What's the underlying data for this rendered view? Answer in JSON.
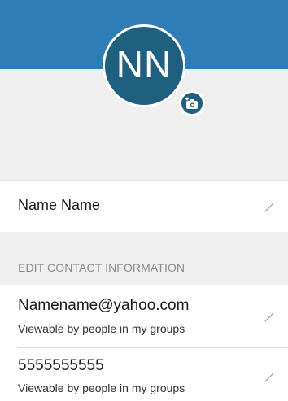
{
  "profile": {
    "initials": "NN",
    "name": "Name Name"
  },
  "section": {
    "header": "EDIT CONTACT INFORMATION"
  },
  "contacts": [
    {
      "value": "Namename@yahoo.com",
      "visibility": "Viewable by people in my groups"
    },
    {
      "value": "5555555555",
      "visibility": "Viewable by people in my groups"
    }
  ],
  "icons": {
    "camera": "camera-plus-icon",
    "edit": "pencil-icon"
  },
  "colors": {
    "header_blue": "#2e7db6",
    "avatar": "#1f5f7f",
    "background_gray": "#efefef"
  }
}
